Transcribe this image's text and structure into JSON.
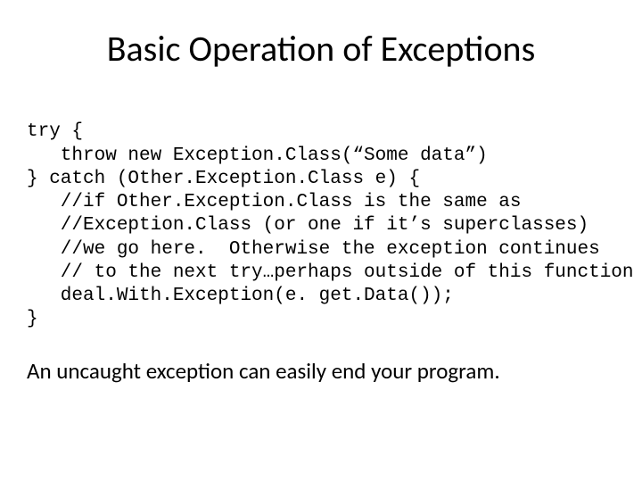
{
  "slide": {
    "title": "Basic Operation of Exceptions",
    "code": {
      "l1": "try {",
      "l2": "   throw new Exception.Class(“Some data”)",
      "l3": "} catch (Other.Exception.Class e) {",
      "l4": "   //if Other.Exception.Class is the same as",
      "l5": "   //Exception.Class (or one if it’s superclasses)",
      "l6": "   //we go here.  Otherwise the exception continues",
      "l7": "   // to the next try…perhaps outside of this function",
      "l8": "   deal.With.Exception(e. get.Data());",
      "l9": "}"
    },
    "footnote": "An uncaught exception can easily end your program."
  }
}
